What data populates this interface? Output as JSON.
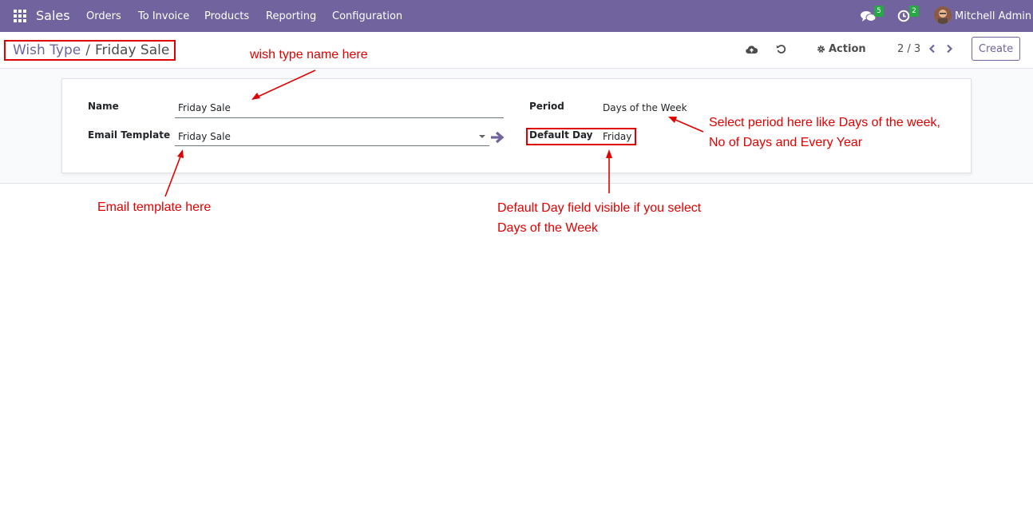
{
  "navbar": {
    "brand": "Sales",
    "menu": [
      "Orders",
      "To Invoice",
      "Products",
      "Reporting",
      "Configuration"
    ],
    "messages_count": "5",
    "activities_count": "2",
    "user_name": "Mitchell Admin",
    "accent_color": "#71639e",
    "badge_color": "#28a745"
  },
  "control_panel": {
    "breadcrumb_parent": "Wish Type",
    "breadcrumb_separator": "/",
    "breadcrumb_current": "Friday Sale",
    "action_label": "Action",
    "pager": "2 / 3",
    "create_label": "Create"
  },
  "form": {
    "name_label": "Name",
    "name_value": "Friday Sale",
    "email_template_label": "Email Template",
    "email_template_value": "Friday Sale",
    "period_label": "Period",
    "period_value": "Days of the Week",
    "default_day_label": "Default Day",
    "default_day_value": "Friday"
  },
  "annotations": {
    "wish_type_name": "wish type name here",
    "email_template": "Email template here",
    "period_line1": "Select period here like Days of the week,",
    "period_line2": "No of Days and Every Year",
    "default_day_line1": "Default Day field visible if you select",
    "default_day_line2": "Days of the Week",
    "annotation_color": "#e00000"
  }
}
